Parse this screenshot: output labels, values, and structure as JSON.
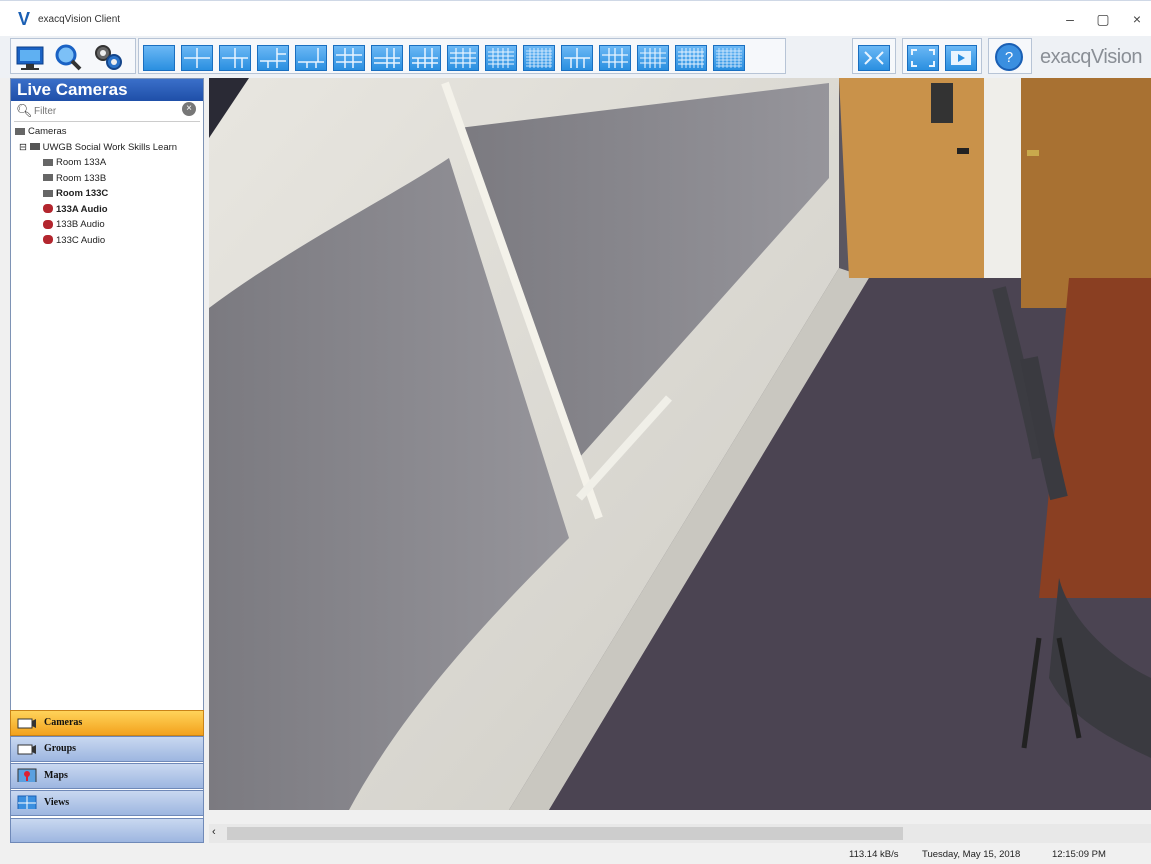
{
  "window": {
    "title": "exacqVision Client",
    "logo_char": "V",
    "minimize": "–",
    "maximize": "▢",
    "close": "×"
  },
  "brand": "exacqVision",
  "toolbar": {
    "icons": [
      "live-view-icon",
      "search-icon",
      "config-icon"
    ],
    "layouts": 17,
    "right_icons": [
      "tour-icon",
      "fullscreen-icon",
      "playback-icon",
      "help-icon"
    ]
  },
  "panel": {
    "title": "Live Cameras",
    "filter_placeholder": "Filter",
    "tree": {
      "root": "Cameras",
      "server": "UWGB Social Work Skills Learn",
      "items": [
        {
          "label": "Room 133A",
          "type": "camera",
          "bold": false
        },
        {
          "label": "Room 133B",
          "type": "camera",
          "bold": false
        },
        {
          "label": "Room 133C",
          "type": "camera",
          "bold": true
        },
        {
          "label": "133A Audio",
          "type": "audio",
          "bold": true
        },
        {
          "label": "133B Audio",
          "type": "audio",
          "bold": false
        },
        {
          "label": "133C Audio",
          "type": "audio",
          "bold": false
        }
      ]
    }
  },
  "nav": [
    {
      "label": "Cameras",
      "active": true
    },
    {
      "label": "Groups",
      "active": false
    },
    {
      "label": "Maps",
      "active": false
    },
    {
      "label": "Views",
      "active": false
    }
  ],
  "status": {
    "bitrate": "113.14 kB/s",
    "date": "Tuesday, May 15, 2018",
    "time": "12:15:09 PM"
  },
  "colors": {
    "accent": "#2a8fe0",
    "panel_head": "#1f4fa8",
    "active_nav": "#f3a21d"
  }
}
